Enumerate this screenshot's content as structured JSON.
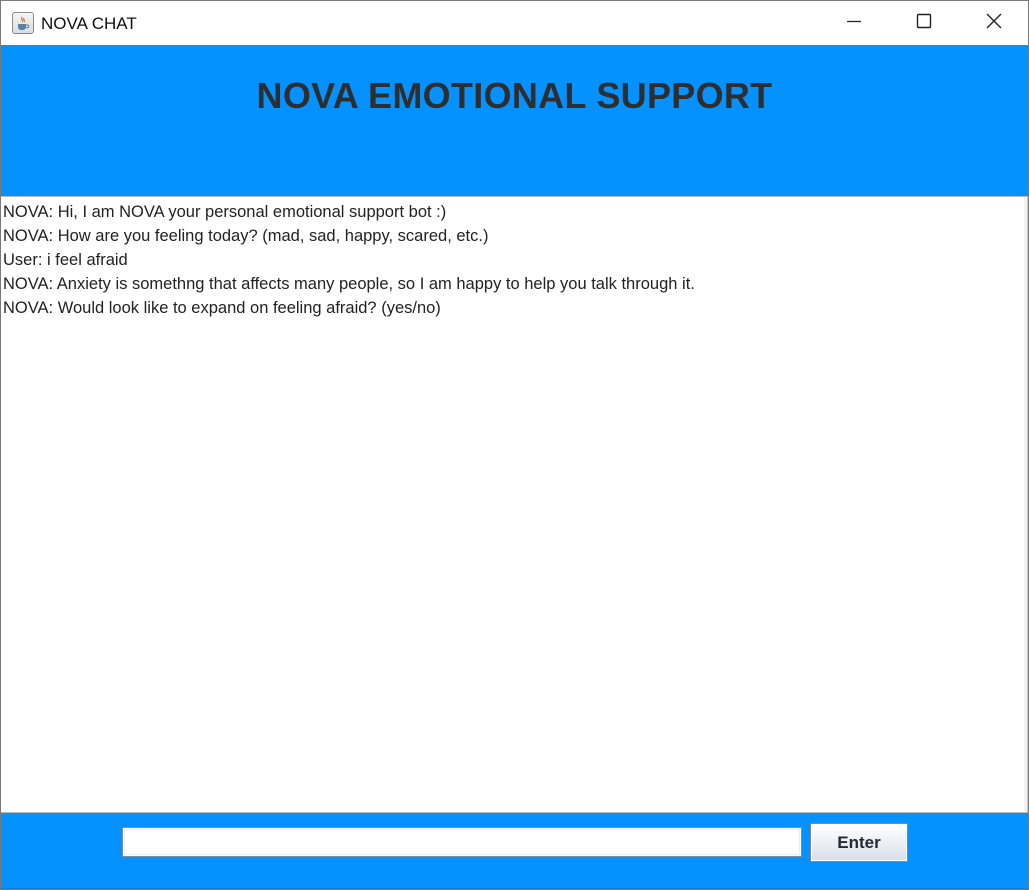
{
  "window": {
    "title": "NOVA CHAT",
    "icon": "java-cup-icon",
    "controls": [
      "minimize-icon",
      "maximize-icon",
      "close-icon"
    ]
  },
  "header": {
    "title": "NOVA EMOTIONAL SUPPORT"
  },
  "chat": {
    "lines": [
      "NOVA: Hi, I am NOVA your personal emotional support bot :)",
      "NOVA: How are you feeling today? (mad, sad, happy, scared, etc.)",
      "User: i feel afraid",
      "NOVA: Anxiety is somethng that affects many people, so I am happy to help you talk through it.",
      "NOVA: Would look like to expand on feeling afraid? (yes/no)"
    ]
  },
  "input": {
    "value": "",
    "enter_label": "Enter"
  },
  "colors": {
    "panel_blue": "#0592ff",
    "title_text": "#2e2e2e"
  }
}
